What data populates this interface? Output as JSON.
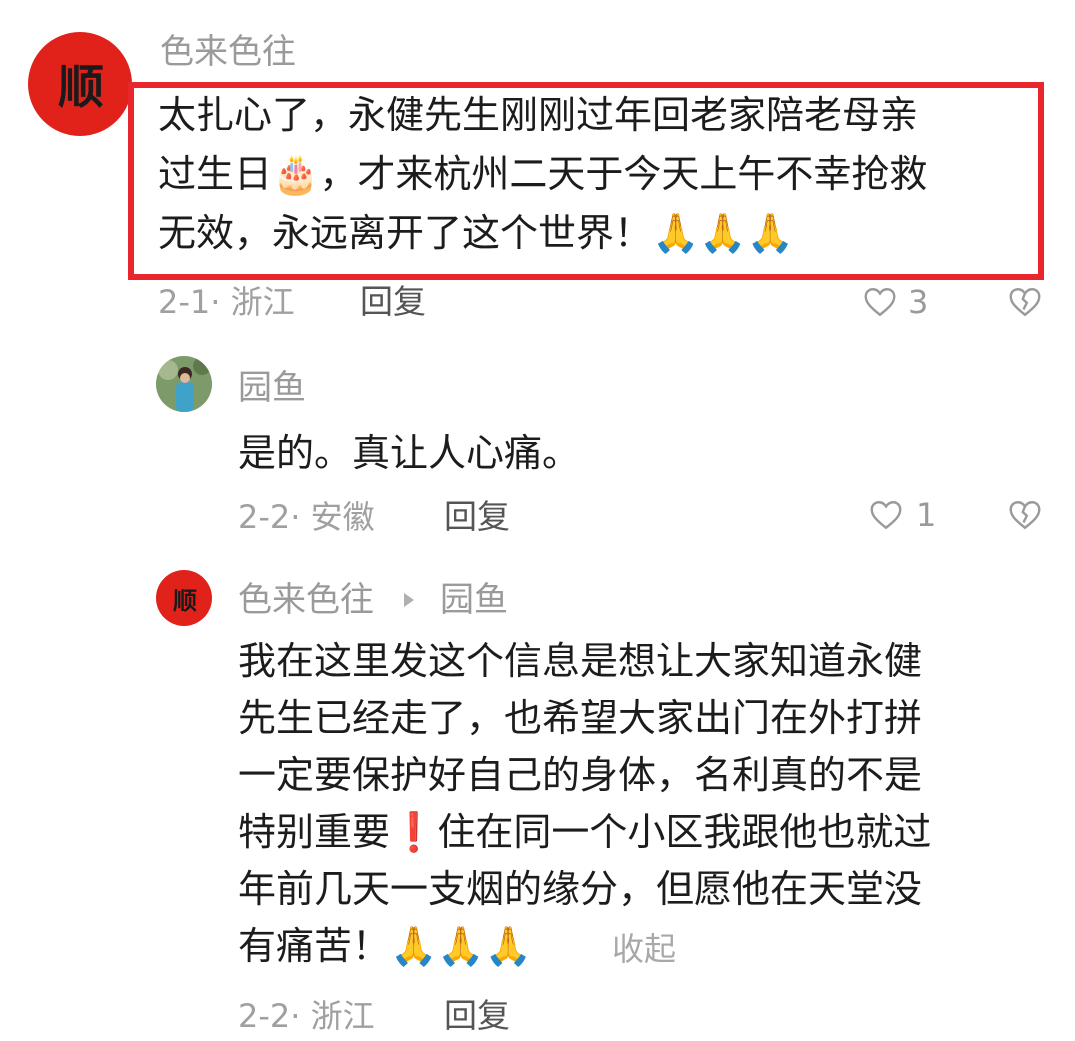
{
  "comments": [
    {
      "avatar_text": "顺",
      "username": "色来色往",
      "lines": [
        "太扎心了，永健先生刚刚过年回老家陪老母亲",
        "过生日🎂，才来杭州二天于今天上午不幸抢救",
        "无效，永远离开了这个世界！🙏🙏🙏"
      ],
      "date_location": "2-1· 浙江",
      "reply_label": "回复",
      "like_count": "3"
    },
    {
      "username": "园鱼",
      "lines": [
        "是的。真让人心痛。"
      ],
      "date_location": "2-2· 安徽",
      "reply_label": "回复",
      "like_count": "1"
    },
    {
      "avatar_text": "顺",
      "username": "色来色往",
      "reply_to": "园鱼",
      "lines": [
        "我在这里发这个信息是想让大家知道永健",
        "先生已经走了，也希望大家出门在外打拼",
        "一定要保护好自己的身体，名利真的不是",
        "特别重要❗住在同一个小区我跟他也就过",
        "年前几天一支烟的缘分，但愿他在天堂没",
        "有痛苦！🙏🙏🙏"
      ],
      "collapse_label": "收起",
      "date_location": "2-2· 浙江",
      "reply_label": "回复"
    }
  ],
  "colors": {
    "highlight_border": "#e8262b",
    "avatar_red": "#e0221b"
  },
  "icons": [
    "heart-outline-icon",
    "broken-heart-icon",
    "reply-arrow-icon"
  ]
}
